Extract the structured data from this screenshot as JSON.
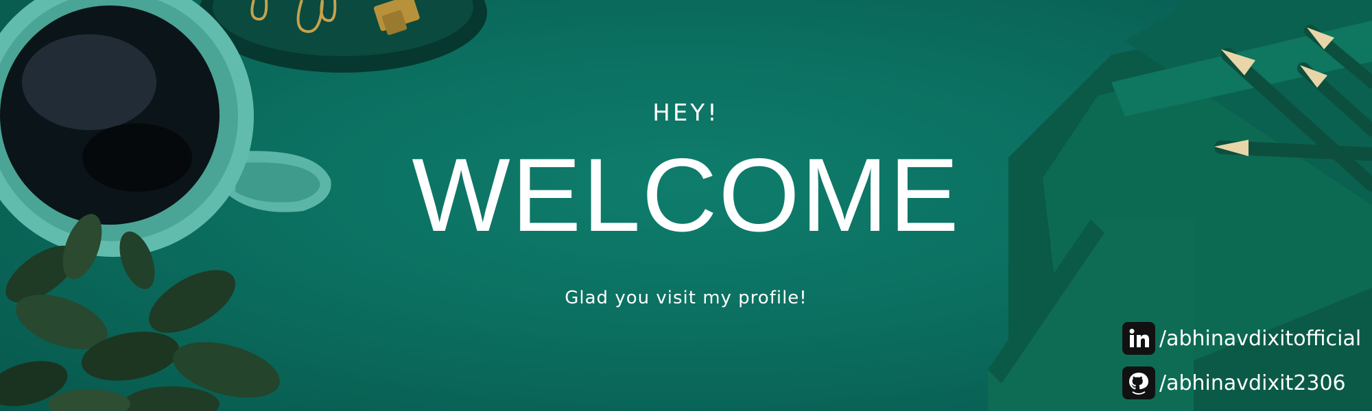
{
  "banner": {
    "hey": "HEY!",
    "welcome": "WELCOME",
    "subtitle": "Glad you visit my profile!"
  },
  "socials": {
    "linkedin": {
      "icon": "linkedin-icon",
      "handle": "/abhinavdixitofficial"
    },
    "github": {
      "icon": "github-icon",
      "handle": "/abhinavdixit2306"
    }
  },
  "colors": {
    "background": "#0b6f60",
    "text": "#ffffff"
  }
}
